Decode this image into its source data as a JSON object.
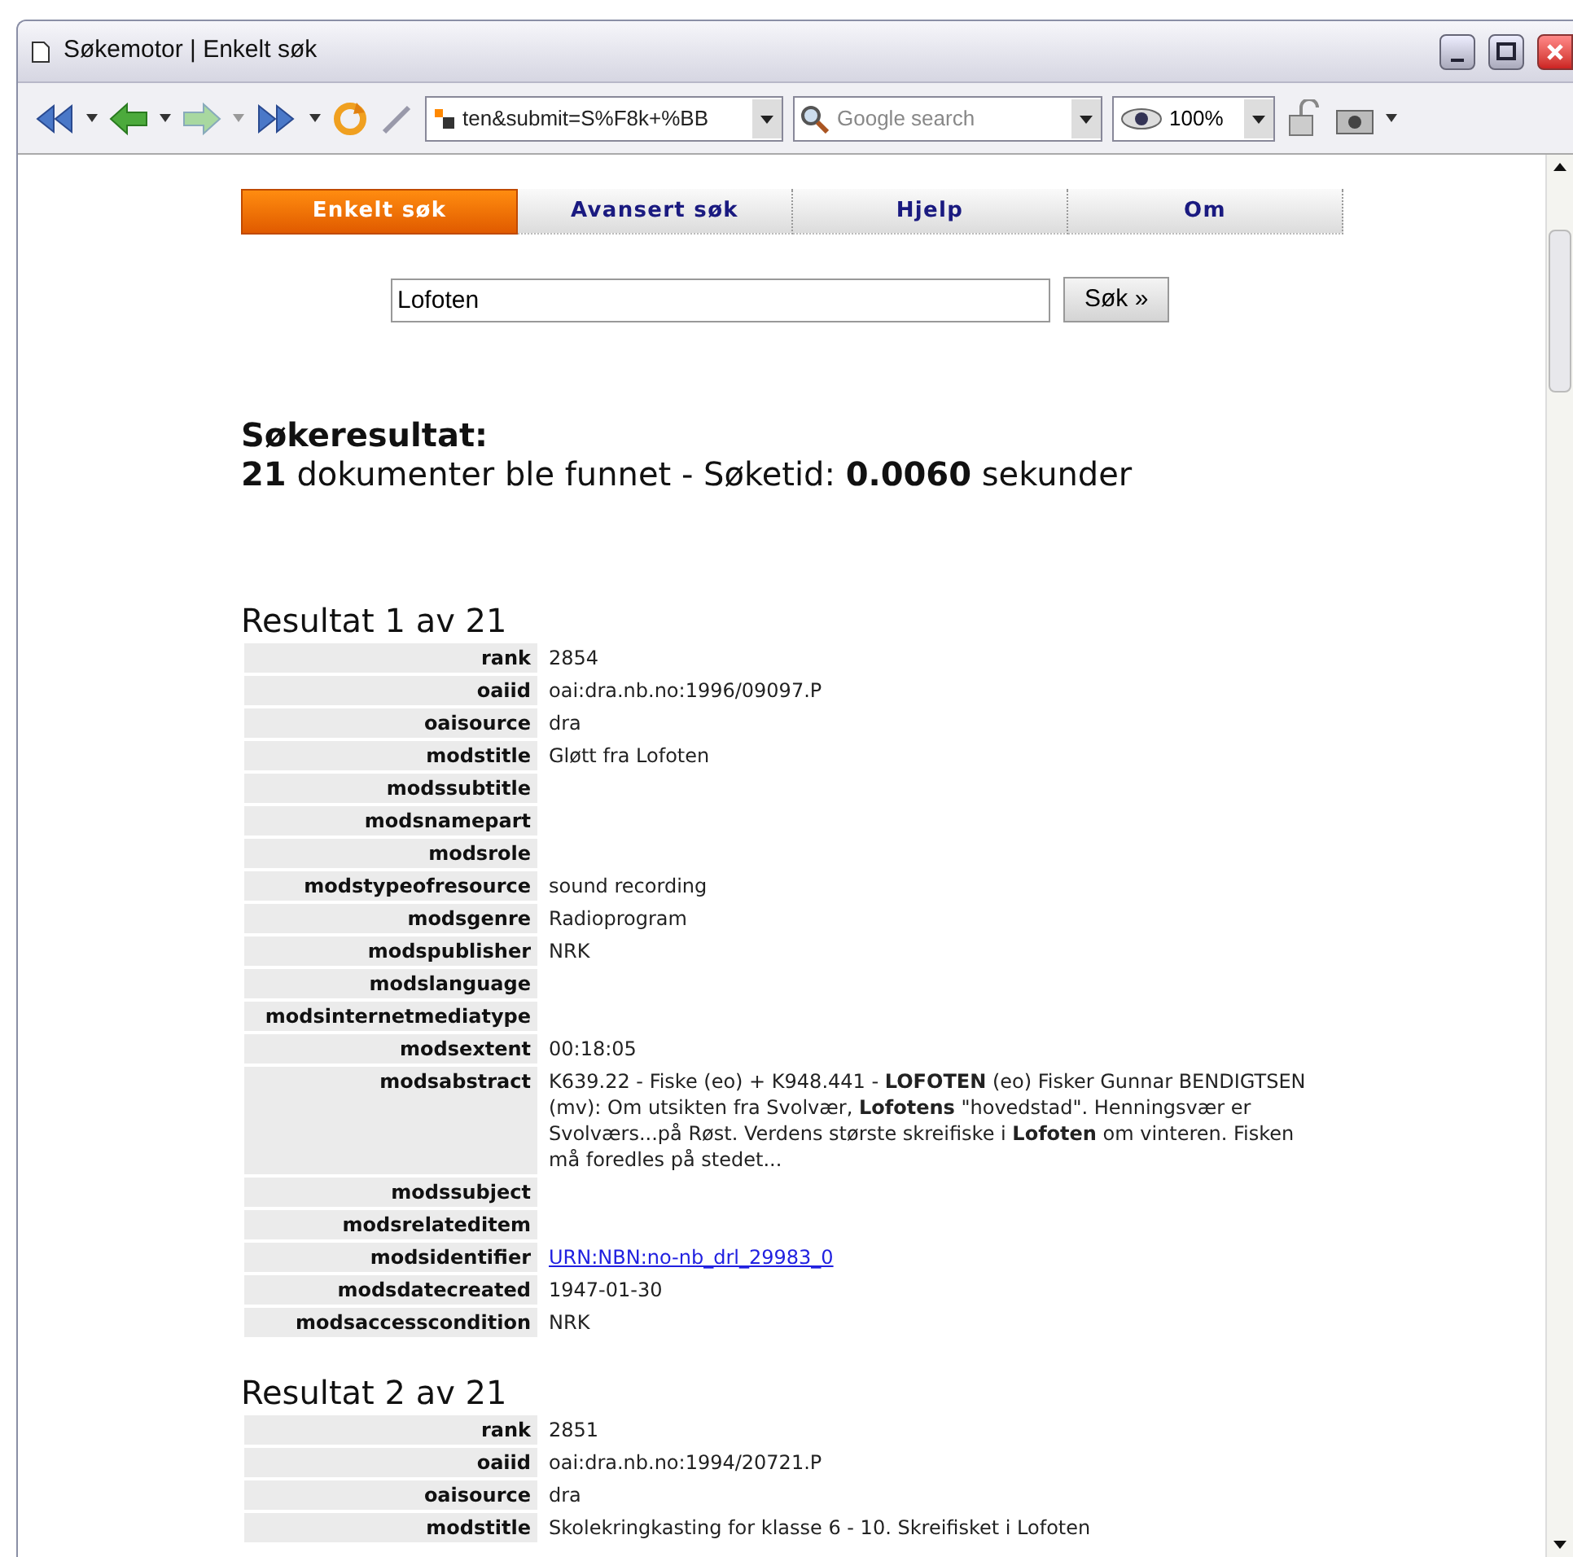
{
  "window": {
    "title": "Søkemotor | Enkelt søk"
  },
  "toolbar": {
    "address": "ten&submit=S%F8k+%BB",
    "search": {
      "placeholder": "Google search"
    },
    "zoom": "100%"
  },
  "tabs": [
    {
      "label": "Enkelt søk",
      "selected": true
    },
    {
      "label": "Avansert søk",
      "selected": false
    },
    {
      "label": "Hjelp",
      "selected": false
    },
    {
      "label": "Om",
      "selected": false
    }
  ],
  "query": {
    "value": "Lofoten",
    "button": "Søk »"
  },
  "summary": {
    "heading": "Søkeresultat:",
    "line": "**21** dokumenter ble funnet - Søketid: **0.0060** sekunder"
  },
  "results": [
    {
      "title": "Resultat 1 av 21",
      "fields": [
        {
          "label": "rank",
          "value": "2854"
        },
        {
          "label": "oaiid",
          "value": "oai:dra.nb.no:1996/09097.P"
        },
        {
          "label": "oaisource",
          "value": "dra"
        },
        {
          "label": "modstitle",
          "value": "Gløtt fra Lofoten"
        },
        {
          "label": "modssubtitle"
        },
        {
          "label": "modsnamepart"
        },
        {
          "label": "modsrole"
        },
        {
          "label": "modstypeofresource",
          "value": "sound recording"
        },
        {
          "label": "modsgenre",
          "value": "Radioprogram"
        },
        {
          "label": "modspublisher",
          "value": "NRK"
        },
        {
          "label": "modslanguage"
        },
        {
          "label": "modsinternetmediatype"
        },
        {
          "label": "modsextent",
          "value": "00:18:05"
        },
        {
          "label": "modsabstract",
          "value": "K639.22 - Fiske (eo) + K948.441 - **LOFOTEN** (eo) Fisker Gunnar BENDIGTSEN (mv): Om utsikten fra Svolvær, **Lofotens** \"hovedstad\". Henningsvær er Svolværs...på Røst. Verdens største skreifiske i **Lofoten** om vinteren. Fisken må foredles på stedet..."
        },
        {
          "label": "modssubject"
        },
        {
          "label": "modsrelateditem"
        },
        {
          "label": "modsidentifier",
          "value": "URN:NBN:no-nb_drl_29983_0",
          "kind": "link"
        },
        {
          "label": "modsdatecreated",
          "value": "1947-01-30"
        },
        {
          "label": "modsaccesscondition",
          "value": "NRK"
        }
      ]
    },
    {
      "title": "Resultat 2 av 21",
      "fields": [
        {
          "label": "rank",
          "value": "2851"
        },
        {
          "label": "oaiid",
          "value": "oai:dra.nb.no:1994/20721.P"
        },
        {
          "label": "oaisource",
          "value": "dra"
        },
        {
          "label": "modstitle",
          "value": "Skolekringkasting for klasse 6 - 10. Skreifisket i Lofoten"
        }
      ]
    }
  ]
}
